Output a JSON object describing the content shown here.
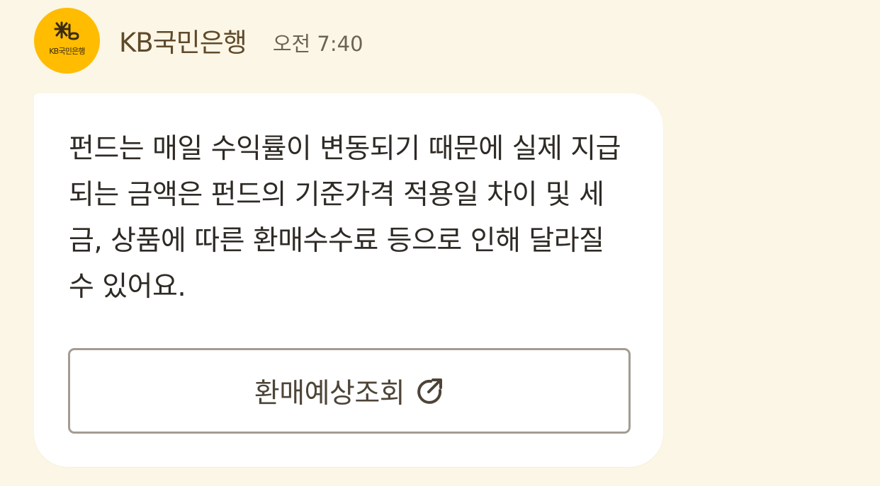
{
  "header": {
    "avatar_text": "KB국민은행",
    "sender_name": "KB국민은행",
    "time": "오전 7:40"
  },
  "message": {
    "text": "펀드는 매일 수익률이 변동되기 때문에 실제 지급되는 금액은 펀드의 기준가격 적용일 차이 및 세금, 상품에 따른 환매수수료 등으로 인해 달라질 수 있어요."
  },
  "button": {
    "label": "환매예상조회",
    "icon": "external-link-icon"
  },
  "colors": {
    "background": "#fcf6e6",
    "bubble": "#ffffff",
    "avatar": "#ffbc00",
    "sender_text": "#5f4a2b",
    "button_border": "#a39c92"
  }
}
